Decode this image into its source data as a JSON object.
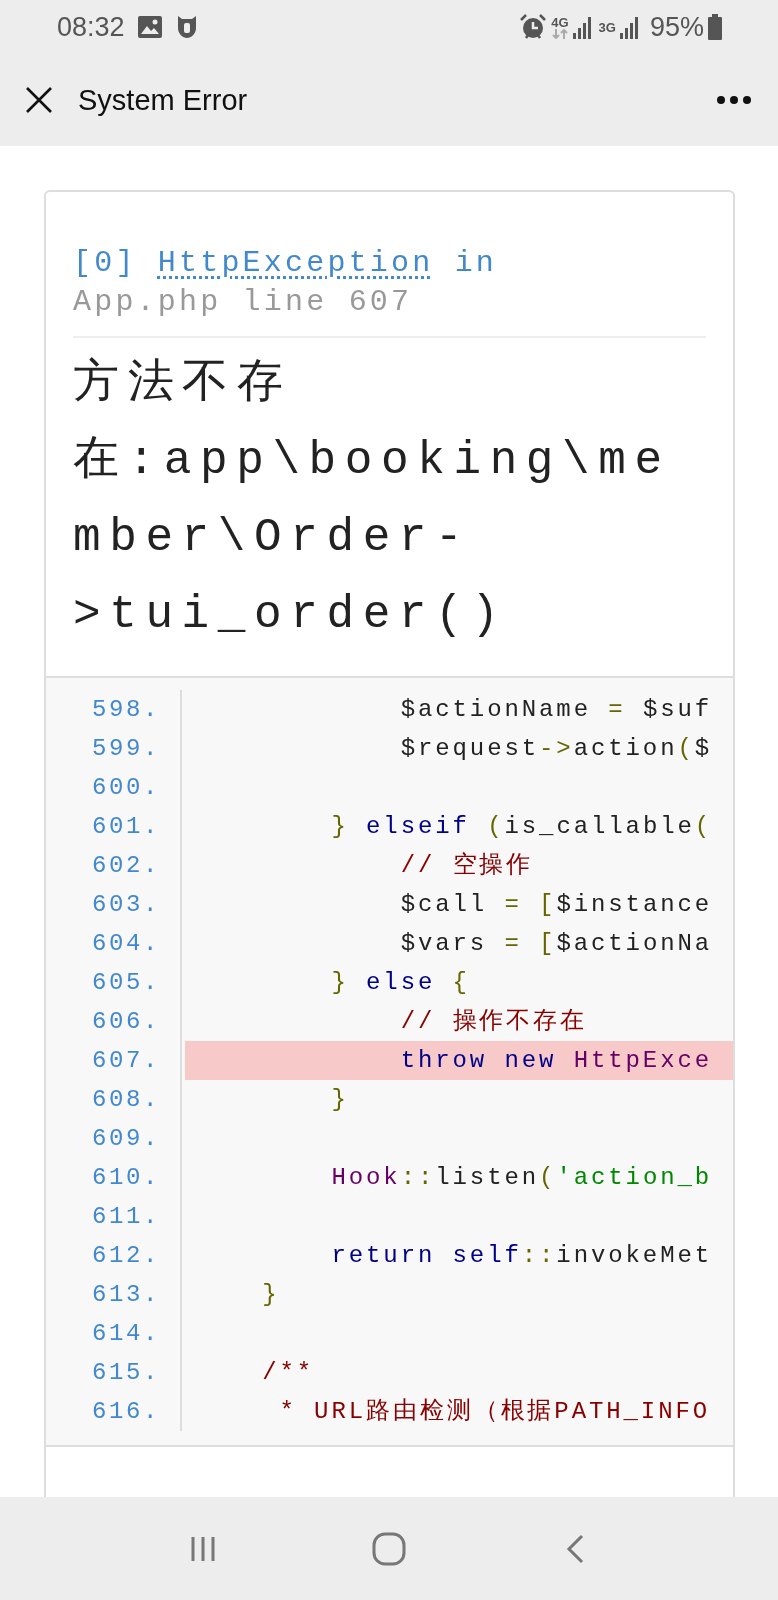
{
  "status_bar": {
    "time": "08:32",
    "network_1": "4G",
    "network_2": "3G",
    "battery": "95%"
  },
  "app_bar": {
    "title": "System Error"
  },
  "error": {
    "index": "[0]",
    "exception": "HttpException",
    "location_joiner": "in",
    "location": "App.php line 607",
    "message": "方法不存在:app\\booking\\member\\Order->tui_order()"
  },
  "code_lines": [
    {
      "number": "598.",
      "highlighted": false,
      "tokens": [
        {
          "text": "            $actionName ",
          "kind": "plain"
        },
        {
          "text": "=",
          "kind": "punc"
        },
        {
          "text": " $suf",
          "kind": "plain"
        }
      ]
    },
    {
      "number": "599.",
      "highlighted": false,
      "tokens": [
        {
          "text": "            $request",
          "kind": "plain"
        },
        {
          "text": "->",
          "kind": "punc"
        },
        {
          "text": "action",
          "kind": "plain"
        },
        {
          "text": "(",
          "kind": "punc"
        },
        {
          "text": "$",
          "kind": "plain"
        }
      ]
    },
    {
      "number": "600.",
      "highlighted": false
    },
    {
      "number": "601.",
      "highlighted": false,
      "tokens": [
        {
          "text": "        }",
          "kind": "punc"
        },
        {
          "text": " elseif ",
          "kind": "kw"
        },
        {
          "text": "(",
          "kind": "punc"
        },
        {
          "text": "is_callable",
          "kind": "plain"
        },
        {
          "text": "(",
          "kind": "punc"
        }
      ]
    },
    {
      "number": "602.",
      "highlighted": false,
      "tokens": [
        {
          "text": "            // 空操作",
          "kind": "cmt"
        }
      ]
    },
    {
      "number": "603.",
      "highlighted": false,
      "tokens": [
        {
          "text": "            $call ",
          "kind": "plain"
        },
        {
          "text": "= [",
          "kind": "punc"
        },
        {
          "text": "$instance",
          "kind": "plain"
        }
      ]
    },
    {
      "number": "604.",
      "highlighted": false,
      "tokens": [
        {
          "text": "            $vars ",
          "kind": "plain"
        },
        {
          "text": "= [",
          "kind": "punc"
        },
        {
          "text": "$actionNa",
          "kind": "plain"
        }
      ]
    },
    {
      "number": "605.",
      "highlighted": false,
      "tokens": [
        {
          "text": "        }",
          "kind": "punc"
        },
        {
          "text": " else ",
          "kind": "kw"
        },
        {
          "text": "{",
          "kind": "punc"
        }
      ]
    },
    {
      "number": "606.",
      "highlighted": false,
      "tokens": [
        {
          "text": "            // 操作不存在",
          "kind": "cmt"
        }
      ]
    },
    {
      "number": "607.",
      "highlighted": true,
      "tokens": [
        {
          "text": "            throw new ",
          "kind": "kw"
        },
        {
          "text": "HttpExce",
          "kind": "cls"
        }
      ]
    },
    {
      "number": "608.",
      "highlighted": false,
      "tokens": [
        {
          "text": "        }",
          "kind": "punc"
        }
      ]
    },
    {
      "number": "609.",
      "highlighted": false
    },
    {
      "number": "610.",
      "highlighted": false,
      "tokens": [
        {
          "text": "        Hook",
          "kind": "cls"
        },
        {
          "text": "::",
          "kind": "punc"
        },
        {
          "text": "listen",
          "kind": "plain"
        },
        {
          "text": "(",
          "kind": "punc"
        },
        {
          "text": "'action_b",
          "kind": "str"
        }
      ]
    },
    {
      "number": "611.",
      "highlighted": false
    },
    {
      "number": "612.",
      "highlighted": false,
      "tokens": [
        {
          "text": "        return self",
          "kind": "kw"
        },
        {
          "text": "::",
          "kind": "punc"
        },
        {
          "text": "invokeMet",
          "kind": "plain"
        }
      ]
    },
    {
      "number": "613.",
      "highlighted": false,
      "tokens": [
        {
          "text": "    }",
          "kind": "punc"
        }
      ]
    },
    {
      "number": "614.",
      "highlighted": false
    },
    {
      "number": "615.",
      "highlighted": false,
      "tokens": [
        {
          "text": "    /**",
          "kind": "cmt"
        }
      ]
    },
    {
      "number": "616.",
      "highlighted": false,
      "tokens": [
        {
          "text": "     * URL路由检测（根据PATH_INFO",
          "kind": "cmt"
        }
      ]
    }
  ]
}
